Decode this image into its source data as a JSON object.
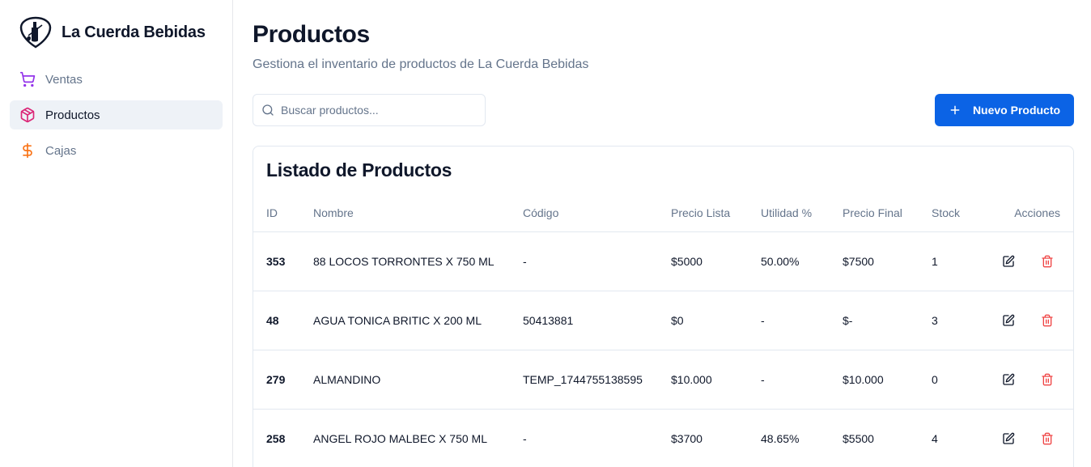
{
  "brand": {
    "name": "La Cuerda Bebidas",
    "logo_icon": "guitar-bottle-logo"
  },
  "sidebar": {
    "items": [
      {
        "label": "Ventas",
        "icon": "shopping-cart-icon",
        "color": "#9333ea",
        "active": false
      },
      {
        "label": "Productos",
        "icon": "package-icon",
        "color": "#db2777",
        "active": true
      },
      {
        "label": "Cajas",
        "icon": "dollar-sign-icon",
        "color": "#f97316",
        "active": false
      }
    ]
  },
  "header": {
    "title": "Productos",
    "subtitle": "Gestiona el inventario de productos de La Cuerda Bebidas"
  },
  "search": {
    "placeholder": "Buscar productos...",
    "value": ""
  },
  "new_button": {
    "label": "Nuevo Producto",
    "color": "#0b63e5"
  },
  "table": {
    "title": "Listado de Productos",
    "columns": [
      "ID",
      "Nombre",
      "Código",
      "Precio Lista",
      "Utilidad %",
      "Precio Final",
      "Stock",
      "Acciones"
    ],
    "rows": [
      {
        "id": "353",
        "nombre": "88 LOCOS TORRONTES X 750 ML",
        "codigo": "-",
        "precio_lista": "$5000",
        "utilidad": "50.00%",
        "precio_final": "$7500",
        "stock": "1"
      },
      {
        "id": "48",
        "nombre": "AGUA TONICA BRITIC X 200 ML",
        "codigo": "50413881",
        "precio_lista": "$0",
        "utilidad": "-",
        "precio_final": "$-",
        "stock": "3"
      },
      {
        "id": "279",
        "nombre": "ALMANDINO",
        "codigo": "TEMP_1744755138595",
        "precio_lista": "$10.000",
        "utilidad": "-",
        "precio_final": "$10.000",
        "stock": "0"
      },
      {
        "id": "258",
        "nombre": "ANGEL ROJO MALBEC X 750 ML",
        "codigo": "-",
        "precio_lista": "$3700",
        "utilidad": "48.65%",
        "precio_final": "$5500",
        "stock": "4"
      }
    ],
    "delete_color": "#ef4444"
  }
}
